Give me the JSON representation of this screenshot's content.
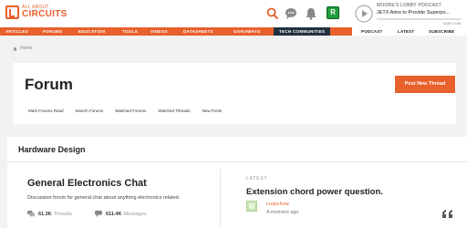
{
  "brand": {
    "line1": "ALL ABOUT",
    "line2": "CIRCUITS"
  },
  "header": {
    "user_initial": "R",
    "podcast": {
      "name": "MOORE'S LOBBY PODCAST",
      "title": "JETX Aims to Provide Superpo...",
      "time": "0:00 / 0:45",
      "progress": 0.0
    }
  },
  "nav": {
    "items": [
      "ARTICLES",
      "FORUMS",
      "EDUCATION",
      "TOOLS",
      "VIDEOS",
      "DATASHEETS",
      "GIVEAWAYS",
      "TECH COMMUNITIES"
    ],
    "right": [
      "PODCAST",
      "LATEST",
      "SUBSCRIBE"
    ]
  },
  "breadcrumb": {
    "home": "Home"
  },
  "forum": {
    "title": "Forum",
    "new_thread": "Post New Thread",
    "tabs": [
      "Mark Forums Read",
      "Search Forums",
      "Watched Forums",
      "Watched Threads",
      "New Posts"
    ]
  },
  "section": {
    "title": "Hardware Design",
    "item": {
      "title": "General Electronics Chat",
      "description": "Discussion forum for general chat about anything electronics related.",
      "threads_value": "61.3K",
      "threads_label": "Threads",
      "messages_value": "611.4K",
      "messages_label": "Messages"
    },
    "latest": {
      "label": "LATEST",
      "title": "Extension chord power question.",
      "user": "crutschow",
      "time": "A moment ago"
    }
  },
  "colors": {
    "accent": "#e8602c",
    "dark_tab": "#22313f",
    "avatar_green": "#1f9e3a"
  }
}
